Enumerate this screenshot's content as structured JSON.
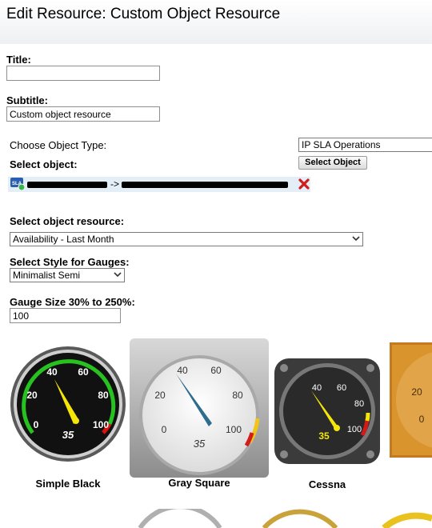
{
  "page": {
    "title": "Edit Resource: Custom Object Resource"
  },
  "form": {
    "title_label": "Title:",
    "title_value": "",
    "subtitle_label": "Subtitle:",
    "subtitle_value": "Custom object resource",
    "object_type_label": "Choose Object Type:",
    "object_type_value": "IP SLA Operations",
    "select_object_label": "Select object:",
    "select_object_button": "Select Object",
    "selected_object_arrow": "->",
    "object_resource_label": "Select object resource:",
    "object_resource_value": "Availability - Last Month",
    "gauge_style_label": "Select Style for Gauges:",
    "gauge_style_value": "Minimalist Semi",
    "gauge_size_label": "Gauge Size 30% to 250%:",
    "gauge_size_value": "100"
  },
  "gauges": [
    {
      "name": "Simple Black",
      "reading": "35",
      "ticks": [
        "0",
        "20",
        "40",
        "60",
        "80",
        "100"
      ]
    },
    {
      "name": "Gray Square",
      "reading": "35",
      "ticks": [
        "0",
        "20",
        "40",
        "60",
        "80",
        "100"
      ]
    },
    {
      "name": "Cessna",
      "reading": "35",
      "ticks": [
        "40",
        "60",
        "80",
        "100"
      ]
    },
    {
      "name": "",
      "reading": "",
      "ticks": [
        "20",
        "0"
      ]
    }
  ],
  "colors": {
    "accent_red": "#d21b1b",
    "highlight_bg": "#e4eef7",
    "needle_yellow": "#f5e60a",
    "needle_blue": "#2f6d8f"
  }
}
